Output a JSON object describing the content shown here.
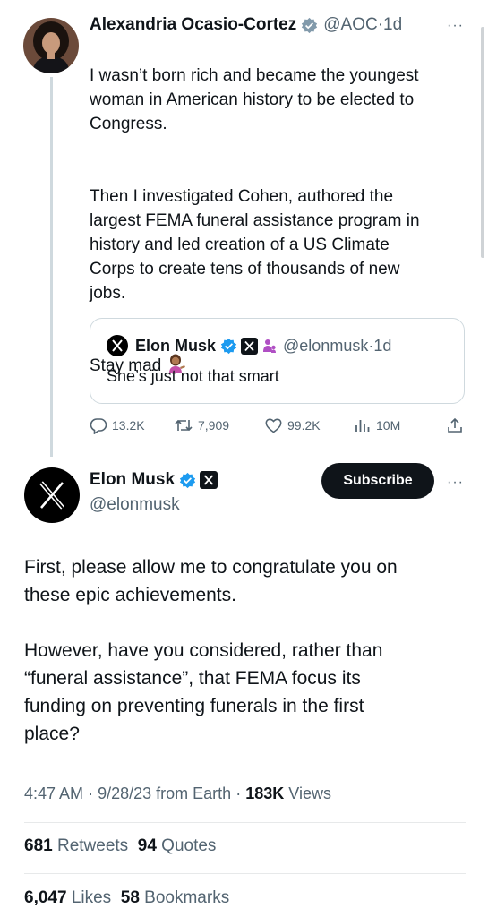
{
  "aoc_tweet": {
    "name": "Alexandria Ocasio-Cortez",
    "handle": "@AOC",
    "separator": "·",
    "time": "1d",
    "more": "···",
    "paragraph1": "I wasn’t born rich and became the youngest\nwoman in American history to be elected to\nCongress.",
    "paragraph2": "Then I investigated Cohen, authored the\nlargest FEMA funeral assistance program in\nhistory and led creation of a US Climate\nCorps to create tens of thousands of new\njobs.",
    "paragraph3": "Stay mad",
    "emoji": "person-tipping-hand-emoji"
  },
  "quote_tweet": {
    "name": "Elon Musk",
    "handle": "@elonmusk",
    "separator": "·",
    "time": "1d",
    "text": "She’s just not that smart"
  },
  "aoc_actions": {
    "replies": "13.2K",
    "reposts": "7,909",
    "likes": "99.2K",
    "views": "10M"
  },
  "musk_tweet": {
    "name": "Elon Musk",
    "handle": "@elonmusk",
    "subscribe_label": "Subscribe",
    "more": "···",
    "paragraph1": "First, please allow me to congratulate you on\nthese epic achievements.",
    "paragraph2": "However, have you considered, rather than\n“funeral assistance”, that FEMA focus its\nfunding on preventing funerals in the first\nplace?",
    "time": "4:47 AM",
    "date": "9/28/23",
    "location": "from Earth",
    "separator": "·",
    "views_count": "183K",
    "views_label": "Views",
    "retweets_count": "681",
    "retweets_label": "Retweets",
    "quotes_count": "94",
    "quotes_label": "Quotes",
    "likes_count": "6,047",
    "likes_label": "Likes",
    "bookmarks_count": "58",
    "bookmarks_label": "Bookmarks"
  },
  "colors": {
    "verified_blue": "#1d9bf0",
    "text": "#0f1419",
    "secondary": "#536471",
    "border": "#cfd9de"
  }
}
